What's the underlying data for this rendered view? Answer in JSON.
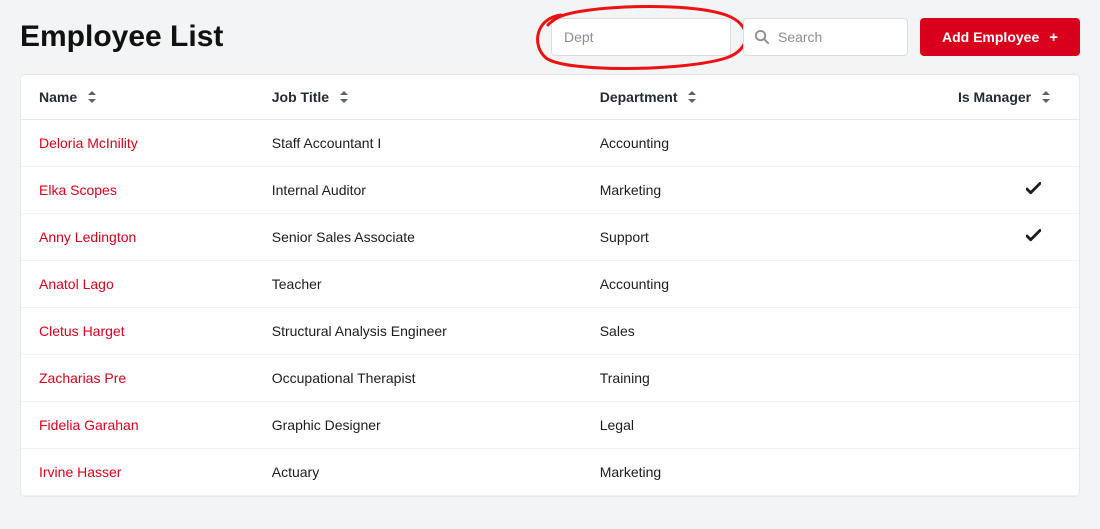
{
  "page": {
    "title": "Employee List"
  },
  "inputs": {
    "dept_placeholder": "Dept",
    "search_placeholder": "Search"
  },
  "buttons": {
    "add_employee": "Add Employee"
  },
  "columns": {
    "name": "Name",
    "job_title": "Job Title",
    "department": "Department",
    "is_manager": "Is Manager"
  },
  "rows": [
    {
      "name": "Deloria McInility",
      "job_title": "Staff Accountant I",
      "department": "Accounting",
      "is_manager": false
    },
    {
      "name": "Elka Scopes",
      "job_title": "Internal Auditor",
      "department": "Marketing",
      "is_manager": true
    },
    {
      "name": "Anny Ledington",
      "job_title": "Senior Sales Associate",
      "department": "Support",
      "is_manager": true
    },
    {
      "name": "Anatol Lago",
      "job_title": "Teacher",
      "department": "Accounting",
      "is_manager": false
    },
    {
      "name": "Cletus Harget",
      "job_title": "Structural Analysis Engineer",
      "department": "Sales",
      "is_manager": false
    },
    {
      "name": "Zacharias Pre",
      "job_title": "Occupational Therapist",
      "department": "Training",
      "is_manager": false
    },
    {
      "name": "Fidelia Garahan",
      "job_title": "Graphic Designer",
      "department": "Legal",
      "is_manager": false
    },
    {
      "name": "Irvine Hasser",
      "job_title": "Actuary",
      "department": "Marketing",
      "is_manager": false
    }
  ]
}
